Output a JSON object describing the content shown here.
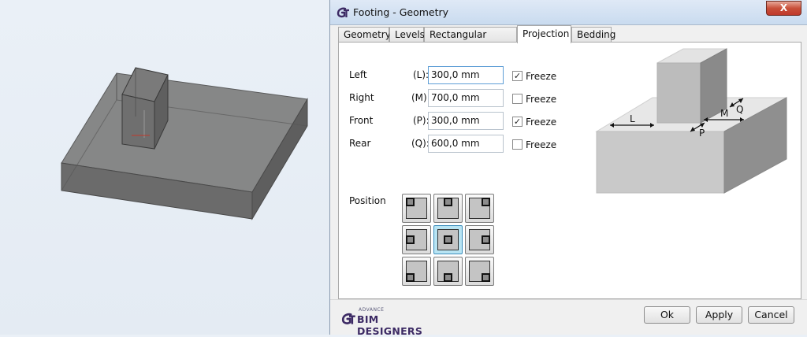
{
  "window": {
    "title": "Footing - Geometry",
    "close_glyph": "X"
  },
  "tabs": [
    {
      "label": "Geometry",
      "active": false
    },
    {
      "label": "Levels",
      "active": false
    },
    {
      "label": "Rectangular Column",
      "active": false
    },
    {
      "label": "Projection",
      "active": true
    },
    {
      "label": "Bedding",
      "active": false
    }
  ],
  "projection": {
    "rows": [
      {
        "label": "Left",
        "code": "(L):",
        "value": "300,0 mm",
        "freeze": true
      },
      {
        "label": "Right",
        "code": "(M):",
        "value": "700,0 mm",
        "freeze": false
      },
      {
        "label": "Front",
        "code": "(P):",
        "value": "300,0 mm",
        "freeze": true
      },
      {
        "label": "Rear",
        "code": "(Q):",
        "value": "600,0 mm",
        "freeze": false
      }
    ],
    "freeze_label": "Freeze",
    "check_glyph": "✓",
    "position_label": "Position",
    "position_selected": "center"
  },
  "diagram": {
    "labels": {
      "L": "L",
      "M": "M",
      "P": "P",
      "Q": "Q"
    }
  },
  "footer": {
    "brand_small": "ADVANCE",
    "brand_main": "BIM DESIGNERS",
    "ok": "Ok",
    "apply": "Apply",
    "cancel": "Cancel"
  },
  "colors": {
    "accent": "#5e9ed6",
    "brand": "#3c2a64",
    "selected_cell": "#b8e4f3"
  }
}
